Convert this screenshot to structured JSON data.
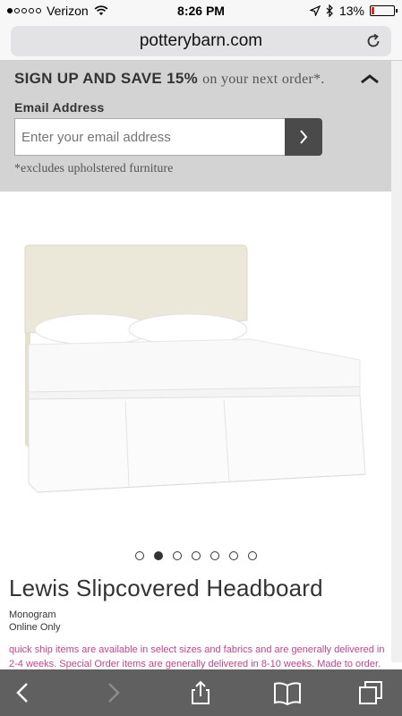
{
  "status": {
    "carrier": "Verizon",
    "time": "8:26 PM",
    "battery": "13%",
    "battery_level": 0.13,
    "signal_bars_filled": 1,
    "signal_bars_total": 5
  },
  "browser": {
    "url": "potterybarn.com"
  },
  "banner": {
    "title_strong": "SIGN UP AND SAVE 15%",
    "title_light": "on your next order*.",
    "email_label": "Email Address",
    "email_placeholder": "Enter your email address",
    "exclusion": "*excludes upholstered furniture"
  },
  "carousel": {
    "count": 7,
    "active_index": 1
  },
  "product": {
    "title": "Lewis Slipcovered Headboard",
    "tags": [
      "Monogram",
      "Online Only"
    ],
    "notice": "quick ship items are available in select sizes and fabrics and are generally delivered in 2-4 weeks. Special Order items are generally delivered in 8-10 weeks. Made to order."
  },
  "colors": {
    "banner_bg": "#d3d3d3",
    "notice": "#c0458a",
    "toolbar_bg": "#606060"
  }
}
